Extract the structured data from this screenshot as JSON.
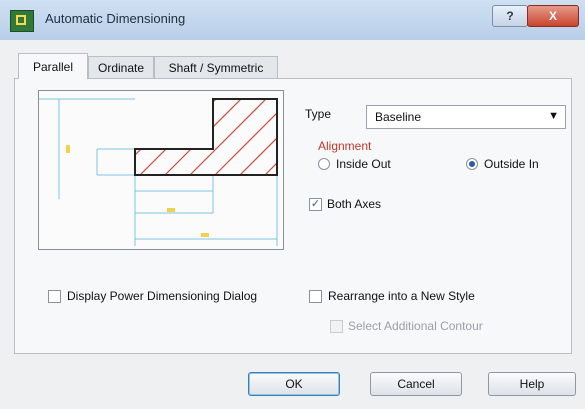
{
  "window": {
    "title": "Automatic Dimensioning",
    "help_glyph": "?",
    "close_glyph": "X"
  },
  "tabs": [
    {
      "label": "Parallel",
      "active": true
    },
    {
      "label": "Ordinate",
      "active": false
    },
    {
      "label": "Shaft / Symmetric",
      "active": false
    }
  ],
  "type": {
    "label": "Type",
    "value": "Baseline",
    "arrow": "▼"
  },
  "alignment": {
    "label": "Alignment",
    "options": [
      {
        "label": "Inside Out",
        "selected": false
      },
      {
        "label": "Outside In",
        "selected": true
      }
    ]
  },
  "both_axes": {
    "label": "Both Axes",
    "checked": true,
    "mark": "✓"
  },
  "display_power_dialog": {
    "label": "Display Power Dimensioning Dialog",
    "checked": false
  },
  "rearrange_style": {
    "label": "Rearrange into a New Style",
    "checked": false
  },
  "select_additional": {
    "label": "Select Additional Contour",
    "checked": false,
    "enabled": false
  },
  "buttons": {
    "ok": "OK",
    "cancel": "Cancel",
    "help": "Help"
  },
  "colors": {
    "hatch": "#d04a3a",
    "dim_lines": "#7cc4e0",
    "accent": "#2b5aa8"
  }
}
